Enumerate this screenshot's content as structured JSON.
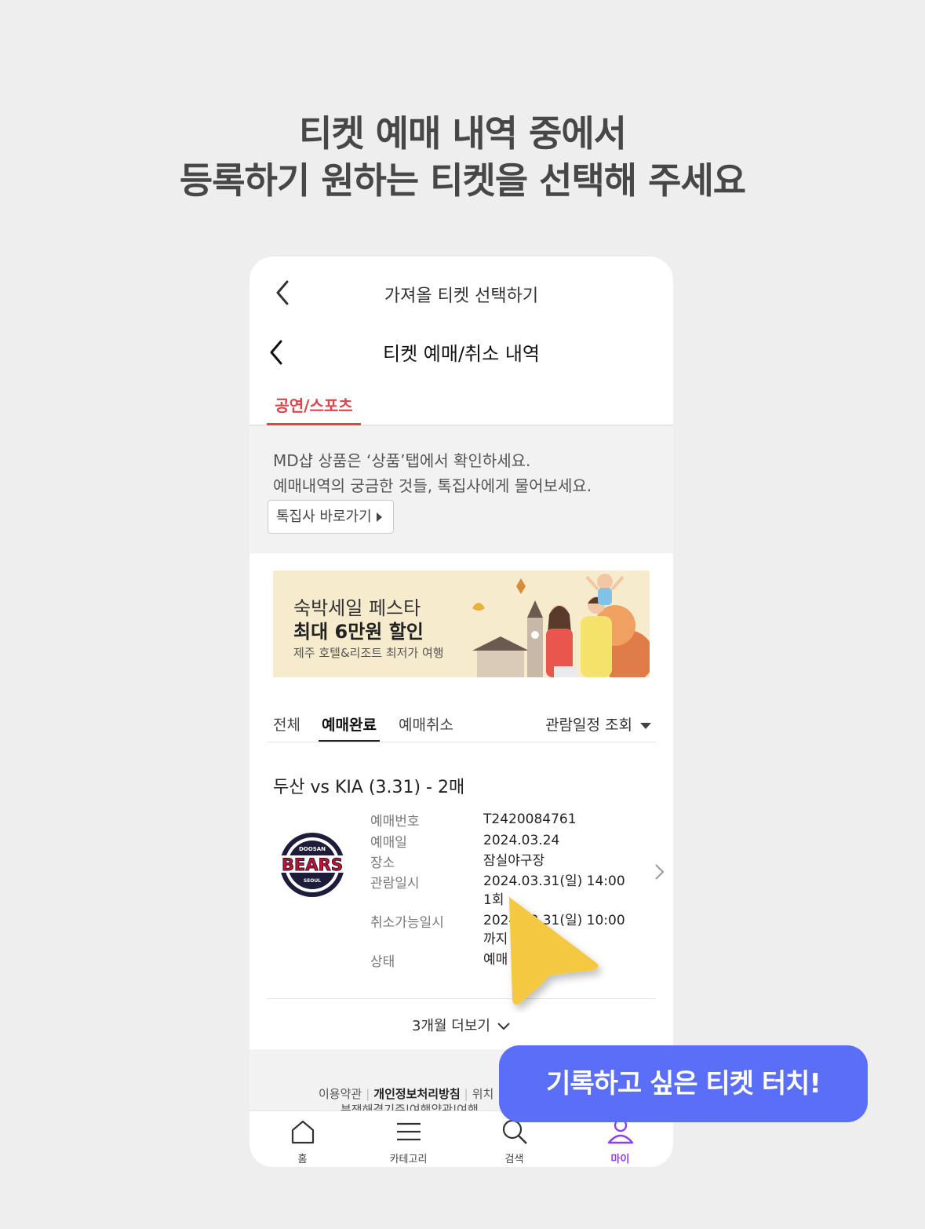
{
  "headline": {
    "line1": "티켓 예매 내역 중에서",
    "line2": "등록하기 원하는 티켓을 선택해 주세요"
  },
  "topbar": {
    "title": "가져올 티켓 선택하기"
  },
  "subbar": {
    "title": "티켓 예매/취소 내역"
  },
  "category_tab": {
    "label": "공연/스포츠",
    "active_color": "#d9474c"
  },
  "notice": {
    "line1": "MD샵 상품은 ‘상품’탭에서 확인하세요.",
    "line2": "예매내역의 궁금한 것들, 톡집사에게 물어보세요.",
    "button": "톡집사 바로가기"
  },
  "banner": {
    "line1": "숙박세일 페스타",
    "line2": "최대 6만원 할인",
    "line3": "제주 호텔&리조트 최저가 여행"
  },
  "filter": {
    "tabs": [
      "전체",
      "예매완료",
      "예매취소"
    ],
    "active_tab": "예매완료",
    "sort_label": "관람일정 조회"
  },
  "ticket": {
    "title": "두산 vs KIA (3.31) - 2매",
    "logo_text": {
      "top": "DOOSAN",
      "main": "BEARS",
      "bottom": "SEOUL"
    },
    "rows": [
      {
        "label": "예매번호",
        "value": "T2420084761"
      },
      {
        "label": "예매일",
        "value": "2024.03.24"
      },
      {
        "label": "장소",
        "value": "잠실야구장"
      },
      {
        "label": "관람일시",
        "value": "2024.03.31(일) 14:00",
        "value2": "1회"
      },
      {
        "label": "취소가능일시",
        "value": "2024.03.31(일) 10:00",
        "value2": "까지"
      },
      {
        "label": "상태",
        "value": "예매"
      }
    ]
  },
  "more_label": "3개월 더보기",
  "footer": {
    "links": [
      "이용약관",
      "개인정보처리방침",
      "위치"
    ],
    "links2": [
      "분쟁해결기준",
      "여행약관",
      "여행"
    ]
  },
  "tabbar": {
    "items": [
      {
        "label": "홈",
        "icon": "home-icon"
      },
      {
        "label": "카테고리",
        "icon": "menu-icon"
      },
      {
        "label": "검색",
        "icon": "search-icon"
      },
      {
        "label": "마이",
        "icon": "user-icon"
      }
    ],
    "active": "마이",
    "active_color": "#8a3ff0"
  },
  "tooltip": {
    "text": "기록하고 싶은 티켓 터치!",
    "color": "#5b6ef7"
  },
  "cursor_color": "#f5c842"
}
